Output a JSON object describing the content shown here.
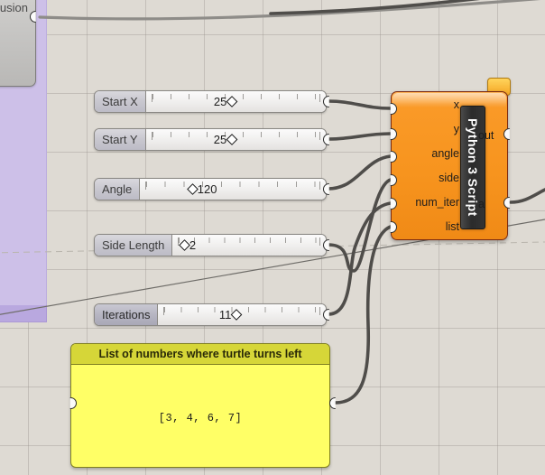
{
  "canvas": {
    "background_color": "#dedad3",
    "grid_color": "#96918a"
  },
  "group": {
    "name": "purple-group",
    "color": "#cdc0e8",
    "footer_color": "#b9a8df"
  },
  "partial_node": {
    "label": "usion",
    "name": "extrusion-node"
  },
  "sliders": [
    {
      "label": "Start X",
      "value": "25",
      "thumb_pct": 52,
      "selected": false
    },
    {
      "label": "Start Y",
      "value": "25",
      "thumb_pct": 52,
      "selected": false
    },
    {
      "label": "Angle",
      "value": "120",
      "thumb_pct": 26,
      "selected": false
    },
    {
      "label": "Side Length",
      "value": "2",
      "thumb_pct": 4,
      "selected": false
    },
    {
      "label": "Iterations",
      "value": "11",
      "thumb_pct": 49,
      "selected": true
    }
  ],
  "python_node": {
    "title": "Python 3 Script",
    "accent_color": "#f7941e",
    "inputs": [
      "x",
      "y",
      "angle",
      "side",
      "num_iter",
      "list"
    ],
    "outputs": [
      "out",
      "a"
    ],
    "warning_badge": "warning-bubble"
  },
  "code_block": {
    "title": "List of numbers where turtle turns left",
    "code": "[3, 4, 6, 7]",
    "body_color": "#ffff66",
    "title_color": "#d6d638"
  }
}
